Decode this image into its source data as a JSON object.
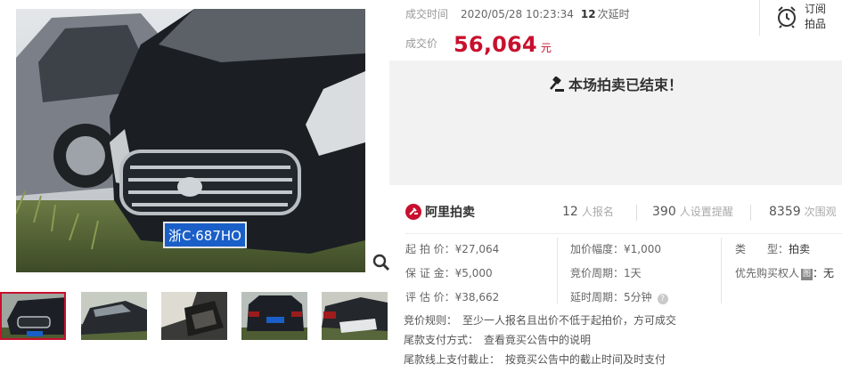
{
  "gallery": {
    "plate_text": "浙C·687HO",
    "thumbnails": [
      {
        "name": "thumb-front",
        "plate": "浙C·687HO"
      },
      {
        "name": "thumb-side"
      },
      {
        "name": "thumb-interior"
      },
      {
        "name": "thumb-rear",
        "plate": "浙C687HO"
      },
      {
        "name": "thumb-damage"
      }
    ]
  },
  "deal": {
    "time_label": "成交时间",
    "time_value": "2020/05/28 10:23:34",
    "extension_count": "12",
    "extension_label": "次延时",
    "price_label": "成交价",
    "price_value": "56,064",
    "price_unit": "元"
  },
  "subscribe": {
    "line1": "订阅",
    "line2": "拍品"
  },
  "banner": {
    "message": "本场拍卖已结束！"
  },
  "brand": {
    "name": "阿里拍卖"
  },
  "stats": {
    "registered": {
      "value": "12",
      "label": "人报名"
    },
    "reminders": {
      "value": "390",
      "label": "人设置提醒"
    },
    "views": {
      "value": "8359",
      "label": "次围观"
    }
  },
  "info": {
    "start_price": {
      "label": "起 拍 价：",
      "value": "¥27,064"
    },
    "deposit": {
      "label": "保 证 金：",
      "value": "¥5,000"
    },
    "appraisal": {
      "label": "评 估 价：",
      "value": "¥38,662"
    },
    "increment": {
      "label": "加价幅度：",
      "value": "¥1,000"
    },
    "cycle": {
      "label": "竞价周期：",
      "value": "1天"
    },
    "extension": {
      "label": "延时周期：",
      "value": "5分钟"
    },
    "type": {
      "label": "类　　型：",
      "value": "拍卖"
    },
    "priority": {
      "label": "优先购买权人",
      "badge": "图",
      "value": "：无"
    }
  },
  "rules": [
    {
      "label": "竞价规则：",
      "value": "至少一人报名且出价不低于起拍价，方可成交"
    },
    {
      "label": "尾款支付方式：",
      "value": "查看竟买公告中的说明"
    },
    {
      "label": "尾款线上支付截止：",
      "value": "按竟买公告中的截止时间及时支付"
    }
  ],
  "colors": {
    "accent": "#c8102e",
    "banner_bg": "#f2f2f2",
    "plate_blue": "#1a5fc7"
  }
}
